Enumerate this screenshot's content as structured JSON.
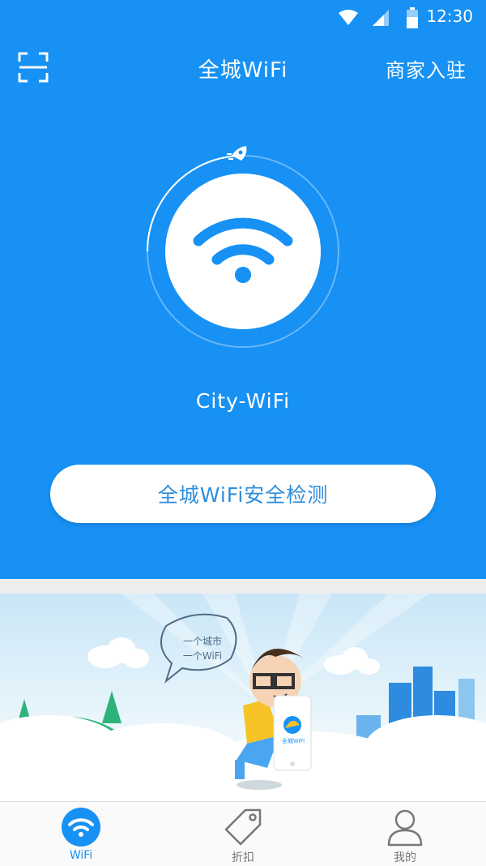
{
  "colors": {
    "primary": "#1791f4",
    "button_text": "#2d8ddc",
    "tab_inactive": "#777777",
    "background_gap": "#eeeeee"
  },
  "status_bar": {
    "time": "12:30",
    "icons": [
      "wifi-signal-icon",
      "cell-signal-icon",
      "battery-icon"
    ]
  },
  "header": {
    "title": "全城WiFi",
    "merchant_label": "商家入驻",
    "scan_icon": "scan-icon"
  },
  "main": {
    "network_name": "City-WiFi",
    "security_button_label": "全城WiFi安全检测"
  },
  "banner": {
    "speech_bubble": [
      "一个城市",
      "一个WiFi"
    ],
    "phone_screen_label": "全城WiFi"
  },
  "tabs": [
    {
      "label": "WiFi",
      "icon": "wifi-icon",
      "active": true
    },
    {
      "label": "折扣",
      "icon": "tag-icon",
      "active": false
    },
    {
      "label": "我的",
      "icon": "person-icon",
      "active": false
    }
  ]
}
